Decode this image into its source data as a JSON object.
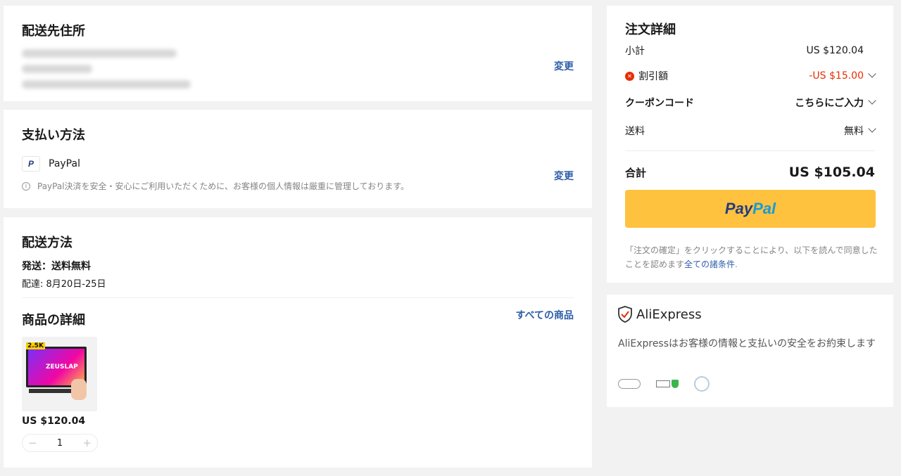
{
  "address": {
    "title": "配送先住所",
    "change_label": "変更"
  },
  "payment": {
    "title": "支払い方法",
    "method": "PayPal",
    "note": "PayPal決済を安全・安心にご利用いただくために、お客様の個人情報は厳重に管理しております。",
    "change_label": "変更"
  },
  "shipping": {
    "title": "配送方法",
    "method": "発送：送料無料",
    "delivery": "配達: 8月20日-25日"
  },
  "product": {
    "title": "商品の詳細",
    "all_items_label": "すべての商品",
    "image_brand": "ZEUSLAP",
    "image_badge": "2.5K",
    "price": "US $120.04",
    "quantity": "1",
    "minus": "−",
    "plus": "+"
  },
  "order": {
    "title": "注文詳細",
    "subtotal_label": "小計",
    "subtotal_value": "US $120.04",
    "discount_label": "割引額",
    "discount_value": "-US $15.00",
    "coupon_label": "クーポンコード",
    "coupon_value": "こちらにご入力",
    "shipping_label": "送料",
    "shipping_value": "無料",
    "total_label": "合計",
    "total_value": "US $105.04",
    "paypal_button_dark": "Pay",
    "paypal_button_light": "Pal",
    "terms_text": "「注文の確定」をクリックすることにより、以下を読んで同意したことを認めます",
    "terms_link": "全ての諸条件",
    "terms_end": "."
  },
  "trust": {
    "brand": "AliExpress",
    "text": "AliExpressはお客様の情報と支払いの安全をお約束します"
  },
  "colors": {
    "accent_blue": "#2e5ea8",
    "discount_red": "#e62e04",
    "paypal_yellow": "#fec23f"
  }
}
